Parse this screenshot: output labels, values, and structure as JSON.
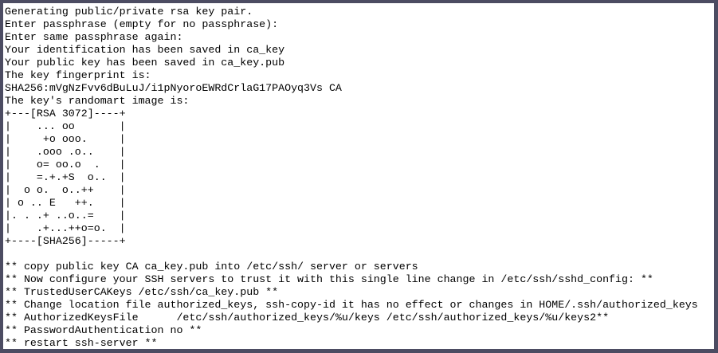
{
  "terminal": {
    "lines": [
      "Generating public/private rsa key pair.",
      "Enter passphrase (empty for no passphrase):",
      "Enter same passphrase again:",
      "Your identification has been saved in ca_key",
      "Your public key has been saved in ca_key.pub",
      "The key fingerprint is:",
      "SHA256:mVgNzFvv6dBuLuJ/i1pNyoroEWRdCrlaG17PAOyq3Vs CA",
      "The key's randomart image is:",
      "+---[RSA 3072]----+",
      "|    ... oo       |",
      "|     +o ooo.     |",
      "|    .ooo .o..    |",
      "|    o= oo.o  .   |",
      "|    =.+.+S  o..  |",
      "|  o o.  o..++    |",
      "| o .. E   ++.    |",
      "|. . .+ ..o..=    |",
      "|    .+...++o=o.  |",
      "+----[SHA256]-----+",
      "",
      "** copy public key CA ca_key.pub into /etc/ssh/ server or servers",
      "** Now configure your SSH servers to trust it with this single line change in /etc/ssh/sshd_config: **",
      "** TrustedUserCAKeys /etc/ssh/ca_key.pub **",
      "** Change location file authorized_keys, ssh-copy-id it has no effect or changes in HOME/.ssh/authorized_keys",
      "** AuthorizedKeysFile      /etc/ssh/authorized_keys/%u/keys /etc/ssh/authorized_keys/%u/keys2**",
      "** PasswordAuthentication no **",
      "** restart ssh-server **"
    ]
  },
  "colors": {
    "frame": "#4c4c62",
    "background": "#ffffff",
    "text": "#000000"
  }
}
